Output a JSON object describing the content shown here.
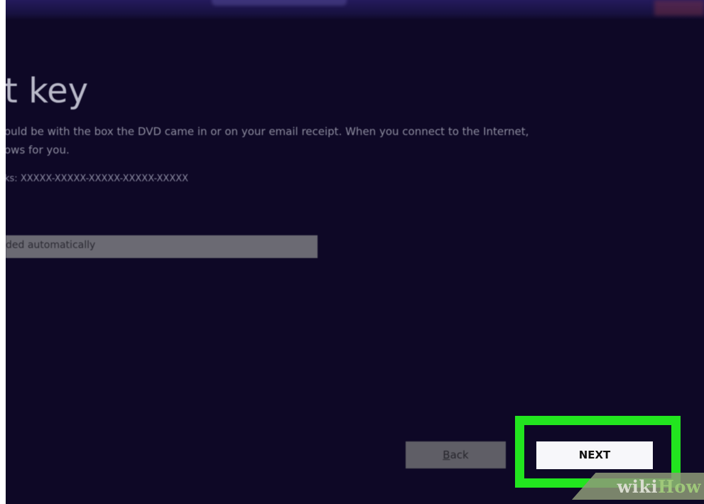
{
  "dialog": {
    "heading": "t key",
    "description_line1": "ould be with the box the DVD came in or on your email receipt.  When you connect to the Internet,",
    "description_line2": "ows for you.",
    "example": "ks: XXXXX-XXXXX-XXXXX-XXXXX-XXXXX",
    "key_field": {
      "value": "ded automatically"
    }
  },
  "buttons": {
    "back_label_initial": "B",
    "back_label_rest": "ack",
    "next_label": "NEXT"
  },
  "watermark": {
    "part1": "wiki",
    "part2": "How"
  },
  "colors": {
    "background": "#0e0826",
    "highlight": "#22e51f",
    "next_button": "#f7f7fa",
    "back_button": "#5f5e66"
  }
}
